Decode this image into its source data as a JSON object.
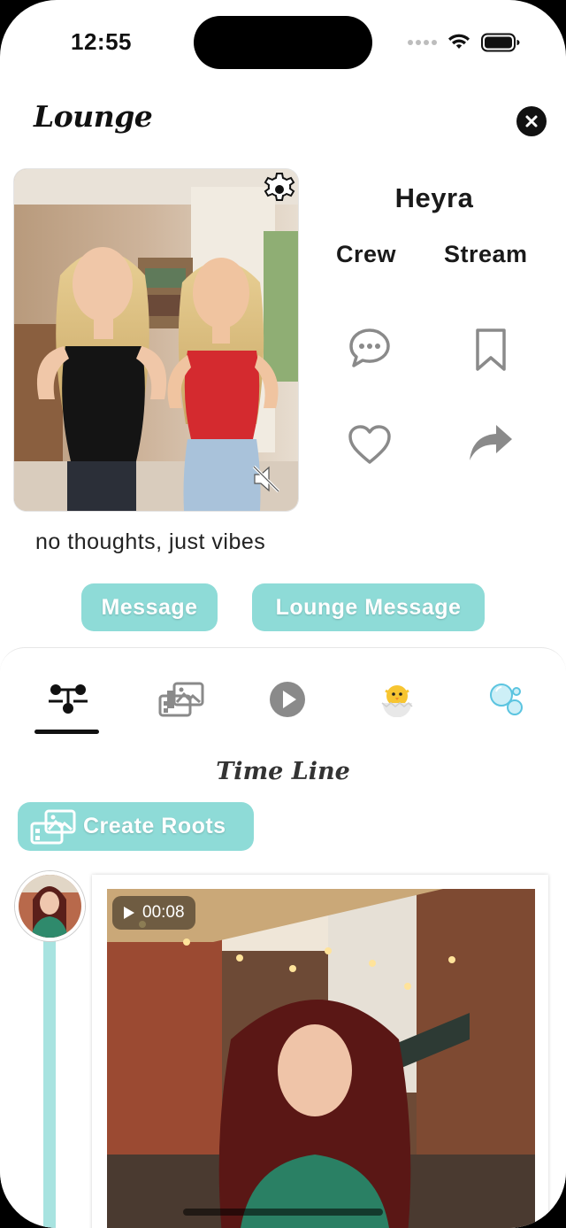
{
  "status_bar": {
    "time": "12:55"
  },
  "header": {
    "logo_text": "Lounge"
  },
  "profile": {
    "name": "Heyra",
    "links": [
      "Crew",
      "Stream"
    ],
    "bio": "no thoughts, just vibes"
  },
  "actions": {
    "message_label": "Message",
    "lounge_message_label": "Lounge Message"
  },
  "tabs": [
    "timeline-tree-icon",
    "gallery-icon",
    "play-icon",
    "chick-icon",
    "bubbles-icon"
  ],
  "timeline": {
    "title": "Time Line",
    "create_label": "Create Roots",
    "post": {
      "duration": "00:08"
    }
  },
  "colors": {
    "accent": "#8edbd7",
    "timeline_line": "#a8e3e0",
    "icon_gray": "#8a8a8a"
  }
}
